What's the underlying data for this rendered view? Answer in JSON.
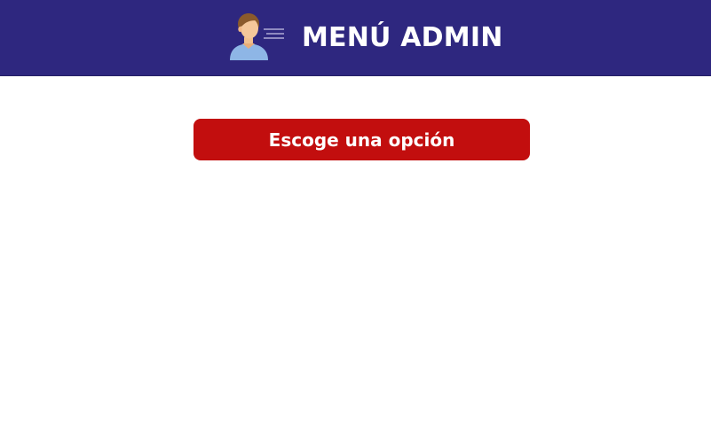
{
  "header": {
    "title": "MENÚ ADMIN",
    "icon": "admin-user-icon",
    "background_color": "#2e277f",
    "text_color": "#ffffff"
  },
  "main": {
    "select_button": {
      "label": "Escoge una opción",
      "background_color": "#c20e0e",
      "text_color": "#ffffff"
    }
  }
}
